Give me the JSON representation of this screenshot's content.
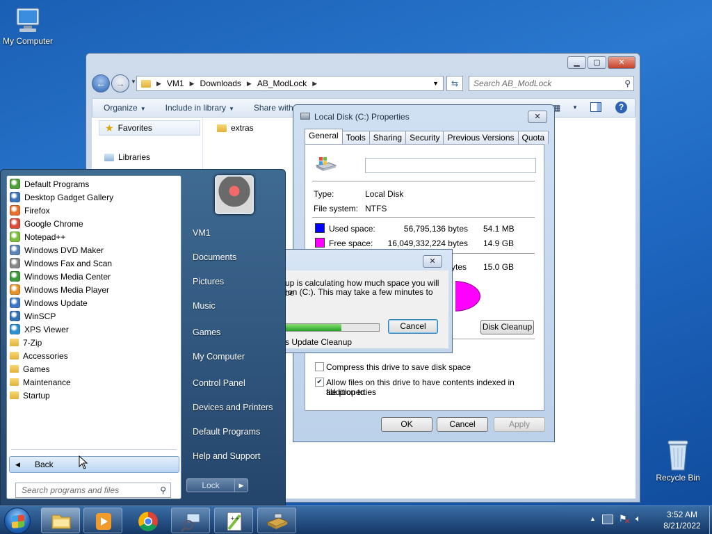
{
  "desktop": {
    "icons": [
      {
        "label": "My Computer",
        "icon": "computer-icon"
      },
      {
        "label": "Recycle Bin",
        "icon": "recycle-bin-icon"
      }
    ]
  },
  "explorer": {
    "breadcrumb": [
      "VM1",
      "Downloads",
      "AB_ModLock"
    ],
    "search_placeholder": "Search AB_ModLock",
    "commands": [
      "Organize",
      "Include in library",
      "Share with"
    ],
    "nav": {
      "favorites": "Favorites",
      "libraries": "Libraries"
    },
    "files": [
      {
        "name": "extras",
        "icon": "folder-icon"
      }
    ]
  },
  "properties": {
    "title": "Local Disk (C:) Properties",
    "tabs": [
      "General",
      "Tools",
      "Sharing",
      "Security",
      "Previous Versions",
      "Quota"
    ],
    "active_tab": "General",
    "name_value": "",
    "type_label": "Type:",
    "type_value": "Local Disk",
    "fs_label": "File system:",
    "fs_value": "NTFS",
    "used": {
      "label": "Used space:",
      "bytes": "56,795,136 bytes",
      "size": "54.1 MB",
      "color": "#0000ff"
    },
    "free": {
      "label": "Free space:",
      "bytes": "16,049,332,224 bytes",
      "size": "14.9 GB",
      "color": "#ff00ff"
    },
    "capacity": {
      "bytes_tail": "ytes",
      "size": "15.0 GB"
    },
    "disk_cleanup": "Disk Cleanup",
    "compress": {
      "label": "Compress this drive to save disk space",
      "checked": false
    },
    "index": {
      "label_line1": "Allow files on this drive to have contents indexed in addition to",
      "label_line2": "file properties",
      "checked": true
    },
    "buttons": {
      "ok": "OK",
      "cancel": "Cancel",
      "apply": "Apply"
    }
  },
  "cleanup": {
    "msg_line1": "up is calculating how much space you will be",
    "msg_line2": "on  (C:). This may take a few minutes to",
    "cancel": "Cancel",
    "status": "s Update Cleanup",
    "progress": 0.6
  },
  "startmenu": {
    "programs": [
      {
        "label": "Default Programs",
        "icon": "default-programs-icon",
        "color": "#4f9d3a"
      },
      {
        "label": "Desktop Gadget Gallery",
        "icon": "gadget-icon",
        "color": "#3c73b8"
      },
      {
        "label": "Firefox",
        "icon": "firefox-icon",
        "color": "#e8702a"
      },
      {
        "label": "Google Chrome",
        "icon": "chrome-icon",
        "color": "#dd4b39"
      },
      {
        "label": "Notepad++",
        "icon": "notepad-plus-icon",
        "color": "#7cbf3a"
      },
      {
        "label": "Windows DVD Maker",
        "icon": "dvd-maker-icon",
        "color": "#5b84b5"
      },
      {
        "label": "Windows Fax and Scan",
        "icon": "fax-scan-icon",
        "color": "#888888"
      },
      {
        "label": "Windows Media Center",
        "icon": "media-center-icon",
        "color": "#3a9a3a"
      },
      {
        "label": "Windows Media Player",
        "icon": "media-player-icon",
        "color": "#e8932a"
      },
      {
        "label": "Windows Update",
        "icon": "windows-update-icon",
        "color": "#3b77c9"
      },
      {
        "label": "WinSCP",
        "icon": "winscp-icon",
        "color": "#2f6fb2"
      },
      {
        "label": "XPS Viewer",
        "icon": "xps-viewer-icon",
        "color": "#2c8fd1"
      },
      {
        "label": "7-Zip",
        "icon": "folder-icon",
        "color": "#e0b23a"
      },
      {
        "label": "Accessories",
        "icon": "folder-icon",
        "color": "#e0b23a"
      },
      {
        "label": "Games",
        "icon": "folder-icon",
        "color": "#e0b23a"
      },
      {
        "label": "Maintenance",
        "icon": "folder-icon",
        "color": "#e0b23a"
      },
      {
        "label": "Startup",
        "icon": "folder-icon",
        "color": "#e0b23a"
      }
    ],
    "back": "Back",
    "search_placeholder": "Search programs and files",
    "right_links": [
      "VM1",
      "Documents",
      "Pictures",
      "Music",
      "Games",
      "My Computer",
      "Control Panel",
      "Devices and Printers",
      "Default Programs",
      "Help and Support"
    ],
    "lock": "Lock"
  },
  "taskbar": {
    "time": "3:52 AM",
    "date": "8/21/2022"
  }
}
